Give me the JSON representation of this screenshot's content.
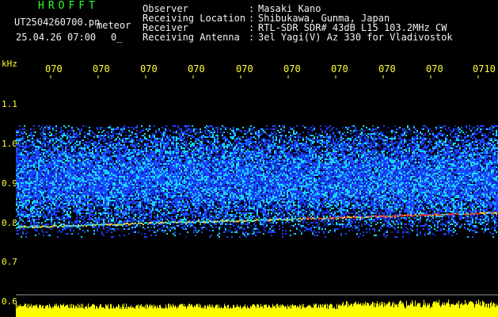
{
  "header": {
    "brand": "HROFFT",
    "filename": "UT2504260700.pn",
    "filename_suffix": "meteor",
    "datetime": "25.04.26 07:00",
    "counter": "0_"
  },
  "station": [
    {
      "label": "Observer",
      "value": "Masaki Kano"
    },
    {
      "label": "Receiving Location",
      "value": "Shibukawa, Gunma, Japan"
    },
    {
      "label": "Receiver",
      "value": "RTL-SDR SDR# 43dB L15 103.2MHz CW"
    },
    {
      "label": "Receiving Antenna",
      "value": "3el Yagi(V) Az 330 for Vladivostok"
    }
  ],
  "axes": {
    "y_unit": "kHz",
    "x_ticks": [
      "070",
      "070",
      "070",
      "070",
      "070",
      "070",
      "070",
      "070",
      "070",
      "0710"
    ],
    "y_ticks": [
      "1.1",
      "1.0",
      "0.9",
      "0.8",
      "0.7",
      "0.6"
    ]
  },
  "colors": {
    "label_green": "#2bff2b",
    "tick_yellow": "#ffff33",
    "noise_blue": "#1e3cff",
    "noise_cyan": "#19d8ff",
    "trace_red": "#ff3b1e",
    "amplitude_yellow": "#ffff00"
  }
}
